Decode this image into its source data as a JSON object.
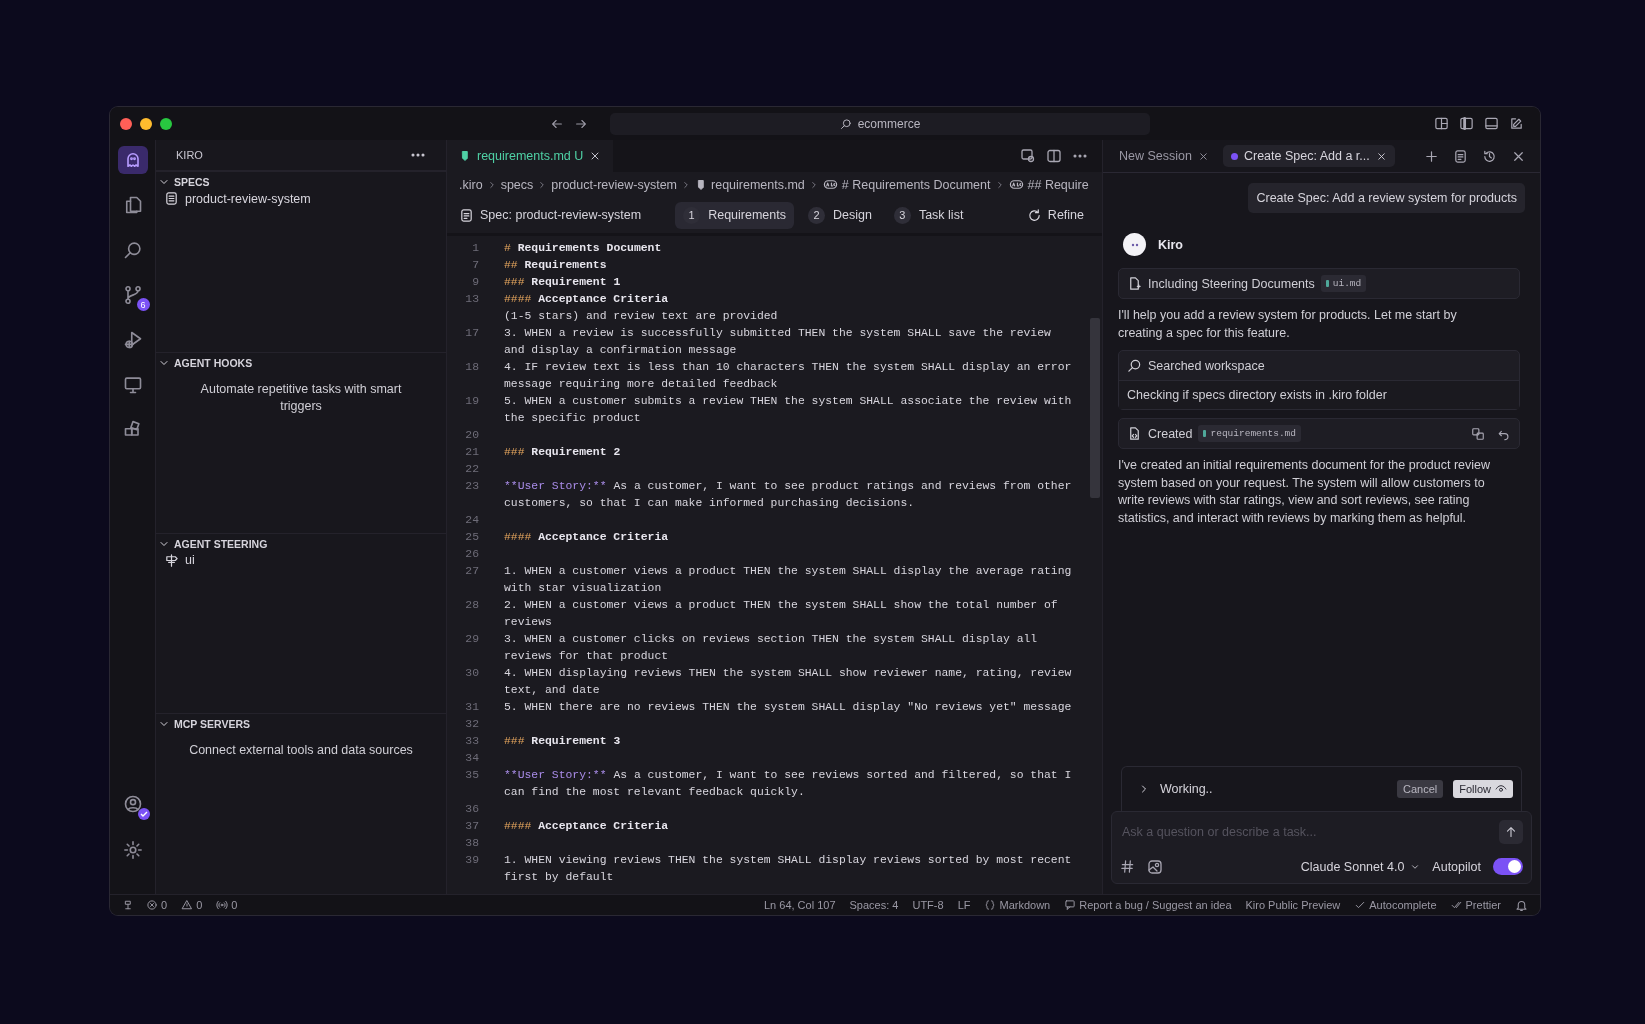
{
  "window": {
    "search": "ecommerce"
  },
  "activity_bar": {
    "items": [
      {
        "kind": "kiro",
        "selected": true
      },
      {
        "kind": "files",
        "selected": false
      },
      {
        "kind": "search",
        "selected": false
      },
      {
        "kind": "source_control",
        "selected": false,
        "badge": "6"
      },
      {
        "kind": "debug",
        "selected": false
      },
      {
        "kind": "remote",
        "selected": false
      },
      {
        "kind": "extensions",
        "selected": false
      }
    ],
    "bottom": [
      {
        "kind": "account"
      },
      {
        "kind": "settings"
      }
    ]
  },
  "sidebar": {
    "title": "KIRO",
    "sections": [
      {
        "title": "SPECS",
        "expanded": true,
        "items": [
          {
            "kind": "spec",
            "label": "product-review-system"
          }
        ]
      },
      {
        "title": "AGENT HOOKS",
        "expanded": true,
        "message": "Automate repetitive tasks with smart triggers"
      },
      {
        "title": "AGENT STEERING",
        "expanded": true,
        "items": [
          {
            "kind": "steering",
            "label": "ui"
          }
        ]
      },
      {
        "title": "MCP SERVERS",
        "expanded": true,
        "message": "Connect external tools and data sources"
      }
    ]
  },
  "editor": {
    "tabs": [
      {
        "label": "requirements.md",
        "badge": "U",
        "selected": true
      }
    ],
    "breadcrumb": [
      {
        "kind": "folder",
        "label": ".kiro"
      },
      {
        "kind": "folder",
        "label": "specs"
      },
      {
        "kind": "folder",
        "label": "product-review-system"
      },
      {
        "kind": "file",
        "label": "requirements.md"
      },
      {
        "kind": "symbol",
        "label": "# Requirements Document"
      },
      {
        "kind": "symbol",
        "label": "## Require"
      }
    ],
    "spec": {
      "title": "Spec: product-review-system",
      "steps": [
        {
          "num": "1",
          "label": "Requirements",
          "selected": true
        },
        {
          "num": "2",
          "label": "Design",
          "selected": false
        },
        {
          "num": "3",
          "label": "Task list",
          "selected": false
        }
      ],
      "refine": "Refine"
    },
    "lines": [
      {
        "num": "1",
        "parts": [
          {
            "kind": "mark",
            "text": "#"
          },
          {
            "kind": "heading",
            "text": " Requirements Document"
          }
        ]
      },
      {
        "num": "7",
        "parts": [
          {
            "kind": "mark",
            "text": "##"
          },
          {
            "kind": "heading",
            "text": " Requirements"
          }
        ]
      },
      {
        "num": "9",
        "parts": [
          {
            "kind": "mark",
            "text": "###"
          },
          {
            "kind": "heading",
            "text": " Requirement 1"
          }
        ]
      },
      {
        "num": "13",
        "parts": [
          {
            "kind": "mark",
            "text": "####"
          },
          {
            "kind": "heading",
            "text": " Acceptance Criteria"
          }
        ]
      },
      {
        "parts": [
          {
            "kind": "plain",
            "text": "(1-5 stars) and review text are provided"
          }
        ]
      },
      {
        "num": "17",
        "parts": [
          {
            "kind": "plain",
            "text": "3. WHEN a review is successfully submitted THEN the system SHALL save the review and display a confirmation message"
          }
        ]
      },
      {
        "num": "18",
        "parts": [
          {
            "kind": "plain",
            "text": "4. IF review text is less than 10 characters THEN the system SHALL display an error message requiring more detailed feedback"
          }
        ]
      },
      {
        "num": "19",
        "parts": [
          {
            "kind": "plain",
            "text": "5. WHEN a customer submits a review THEN the system SHALL associate the review with the specific product"
          }
        ]
      },
      {
        "num": "20"
      },
      {
        "num": "21",
        "parts": [
          {
            "kind": "mark",
            "text": "###"
          },
          {
            "kind": "heading",
            "text": " Requirement 2"
          }
        ]
      },
      {
        "num": "22"
      },
      {
        "num": "23",
        "parts": [
          {
            "kind": "emph",
            "text": "**User Story:**"
          },
          {
            "kind": "plain",
            "text": " As a customer, I want to see product ratings and reviews from other customers, so that I can make informed purchasing decisions."
          }
        ]
      },
      {
        "num": "24"
      },
      {
        "num": "25",
        "parts": [
          {
            "kind": "mark",
            "text": "####"
          },
          {
            "kind": "heading",
            "text": " Acceptance Criteria"
          }
        ]
      },
      {
        "num": "26"
      },
      {
        "num": "27",
        "parts": [
          {
            "kind": "plain",
            "text": "1. WHEN a customer views a product THEN the system SHALL display the average rating with star visualization"
          }
        ]
      },
      {
        "num": "28",
        "parts": [
          {
            "kind": "plain",
            "text": "2. WHEN a customer views a product THEN the system SHALL show the total number of reviews"
          }
        ]
      },
      {
        "num": "29",
        "parts": [
          {
            "kind": "plain",
            "text": "3. WHEN a customer clicks on reviews section THEN the system SHALL display all reviews for that product"
          }
        ]
      },
      {
        "num": "30",
        "parts": [
          {
            "kind": "plain",
            "text": "4. WHEN displaying reviews THEN the system SHALL show reviewer name, rating, review text, and date"
          }
        ]
      },
      {
        "num": "31",
        "parts": [
          {
            "kind": "plain",
            "text": "5. WHEN there are no reviews THEN the system SHALL display \"No reviews yet\" message"
          }
        ]
      },
      {
        "num": "32"
      },
      {
        "num": "33",
        "parts": [
          {
            "kind": "mark",
            "text": "###"
          },
          {
            "kind": "heading",
            "text": " Requirement 3"
          }
        ]
      },
      {
        "num": "34"
      },
      {
        "num": "35",
        "parts": [
          {
            "kind": "emph",
            "text": "**User Story:**"
          },
          {
            "kind": "plain",
            "text": " As a customer, I want to see reviews sorted and filtered, so that I can find the most relevant feedback quickly."
          }
        ]
      },
      {
        "num": "36"
      },
      {
        "num": "37",
        "parts": [
          {
            "kind": "mark",
            "text": "####"
          },
          {
            "kind": "heading",
            "text": " Acceptance Criteria"
          }
        ]
      },
      {
        "num": "38"
      },
      {
        "num": "39",
        "parts": [
          {
            "kind": "plain",
            "text": "1. WHEN viewing reviews THEN the system SHALL display reviews sorted by most recent first by default"
          }
        ]
      }
    ]
  },
  "chat": {
    "tabs": [
      {
        "label": "New Session",
        "selected": false,
        "dot": false
      },
      {
        "label": "Create Spec: Add a r...",
        "selected": true,
        "dot": true
      }
    ],
    "user_message": "Create Spec: Add a review system for products",
    "agent": "Kiro",
    "messages": [
      {
        "kind": "steering",
        "label": "Including Steering Documents",
        "file": "ui.md"
      },
      {
        "kind": "text",
        "text": "I'll help you add a review system for products. Let me start by creating a spec for this feature."
      },
      {
        "kind": "search",
        "label": "Searched workspace",
        "detail": "Checking if specs directory exists in .kiro folder"
      },
      {
        "kind": "created",
        "label": "Created",
        "file": "requirements.md"
      },
      {
        "kind": "text",
        "text": "I've created an initial requirements document for the product review system based on your request. The system will allow customers to write reviews with star ratings, view and sort reviews, see rating statistics, and interact with reviews by marking them as helpful."
      }
    ],
    "working": {
      "label": "Working..",
      "cancel": "Cancel",
      "follow": "Follow"
    },
    "input": {
      "placeholder": "Ask a question or describe a task..."
    },
    "model": "Claude Sonnet 4.0",
    "autopilot": {
      "label": "Autopilot",
      "on": true
    }
  },
  "status_bar": {
    "left": [
      {
        "kind": "error",
        "text": "0"
      },
      {
        "kind": "warning",
        "text": "0"
      },
      {
        "kind": "ports",
        "text": "0"
      }
    ],
    "right": [
      {
        "kind": "plain",
        "text": "Ln 64, Col 107"
      },
      {
        "kind": "plain",
        "text": "Spaces: 4"
      },
      {
        "kind": "plain",
        "text": "UTF-8"
      },
      {
        "kind": "plain",
        "text": "LF"
      },
      {
        "kind": "braces",
        "text": "Markdown"
      },
      {
        "kind": "feedback",
        "text": "Report a bug / Suggest an idea"
      },
      {
        "kind": "plain",
        "text": "Kiro Public Preview"
      },
      {
        "kind": "check",
        "text": "Autocomplete"
      },
      {
        "kind": "checks",
        "text": "Prettier"
      },
      {
        "kind": "bell"
      }
    ]
  }
}
